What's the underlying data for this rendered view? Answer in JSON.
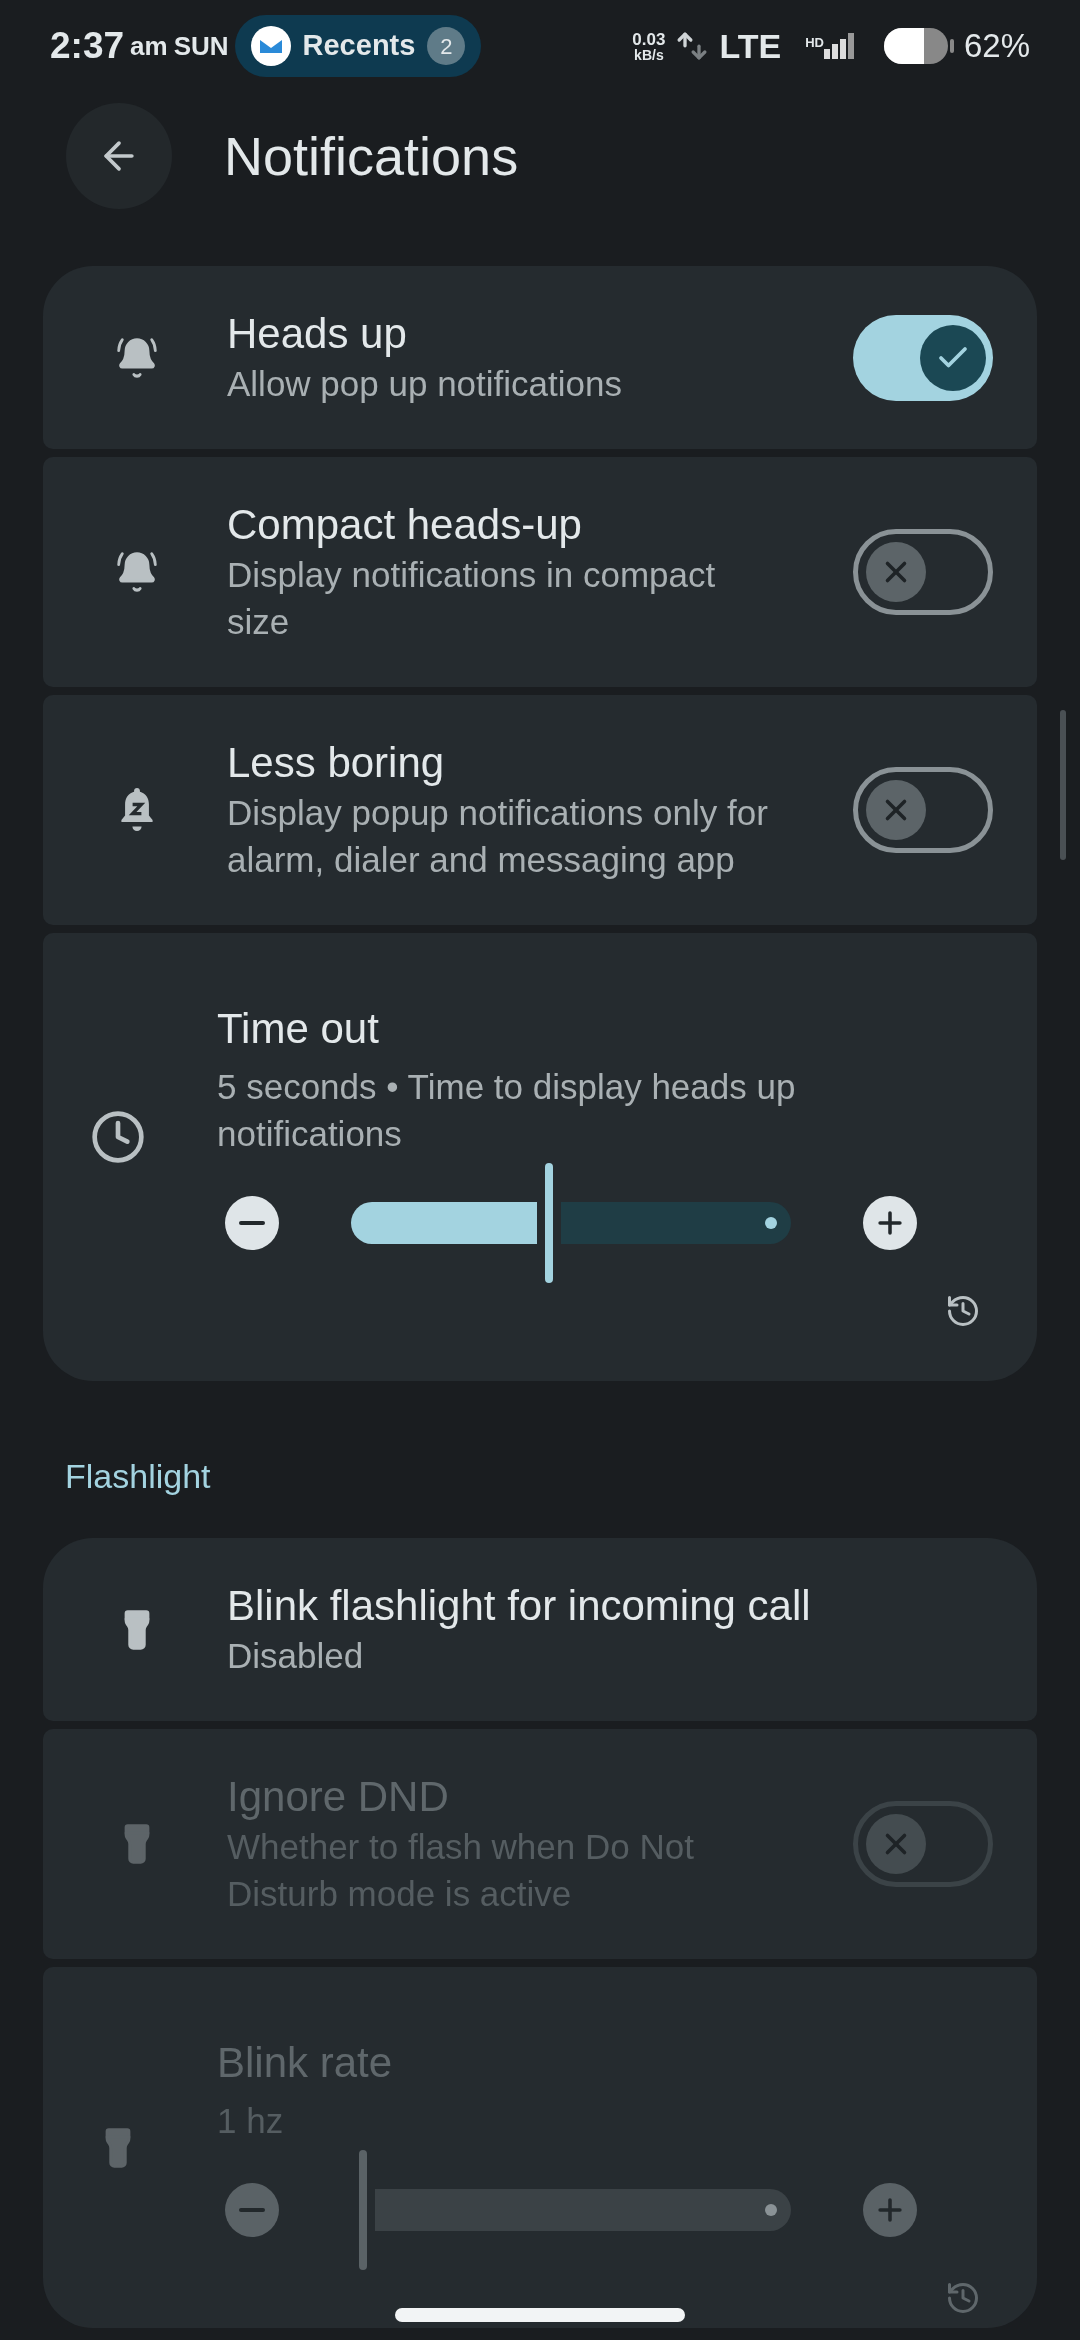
{
  "status_bar": {
    "time": "2:37",
    "meridiem": "am",
    "day": "SUN",
    "recents": {
      "label": "Recents",
      "count": "2"
    },
    "speed": "0.03",
    "speed_unit": "kB/s",
    "network": "LTE",
    "signal_label": "HD",
    "battery_text": "62%"
  },
  "header": {
    "title": "Notifications"
  },
  "sections": [
    {
      "cards": [
        {
          "kind": "toggle",
          "title": "Heads up",
          "subtitle": "Allow pop up notifications",
          "on": true,
          "disabled": false
        },
        {
          "kind": "toggle",
          "title": "Compact heads-up",
          "subtitle": "Display notifications in compact size",
          "on": false,
          "disabled": false
        },
        {
          "kind": "toggle",
          "title": "Less boring",
          "subtitle": "Display popup notifications only for alarm, dialer and messaging app",
          "on": false,
          "disabled": false
        },
        {
          "kind": "slider",
          "title": "Time out",
          "subtitle": "5 seconds • Time to display heads up notifications",
          "level": 0.45,
          "disabled": false
        }
      ]
    },
    {
      "title": "Flashlight",
      "cards": [
        {
          "kind": "info",
          "title": "Blink flashlight for incoming call",
          "subtitle": "Disabled",
          "disabled": false
        },
        {
          "kind": "toggle",
          "title": "Ignore DND",
          "subtitle": "Whether to flash when Do Not Disturb mode is active",
          "on": false,
          "disabled": true
        },
        {
          "kind": "slider",
          "title": "Blink rate",
          "subtitle": "1 hz",
          "level": 0,
          "disabled": true
        }
      ]
    }
  ]
}
